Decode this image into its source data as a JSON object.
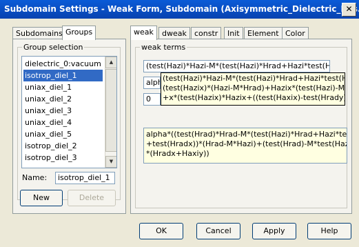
{
  "window": {
    "title": "Subdomain Settings - Weak Form, Subdomain (Axisymmetric_Dielectric_Res...",
    "close_glyph": "✕"
  },
  "left_tabs": [
    "Subdomains",
    "Groups"
  ],
  "group_selection": {
    "label": "Group selection",
    "items": [
      "dielectric_0:vacuum",
      "isotrop_diel_1",
      "uniax_diel_1",
      "uniax_diel_2",
      "uniax_diel_3",
      "uniax_diel_4",
      "uniax_diel_5",
      "isotrop_diel_2",
      "isotrop_diel_3"
    ],
    "selected_index": 1
  },
  "name_field": {
    "label": "Name:",
    "value": "isotrop_diel_1"
  },
  "left_buttons": {
    "new": "New",
    "delete": "Delete"
  },
  "right_tabs": [
    "weak",
    "dweak",
    "constr",
    "Init",
    "Element",
    "Color"
  ],
  "weak_terms": {
    "label": "weak terms",
    "field1": "(test(Hazi)*Hazi-M*(test(Hazi)*Hrad+Hazi*test(H",
    "field2": "alpha",
    "field3": "0",
    "tooltip_lines": [
      "(test(Hazi)*Hazi-M*(test(Hazi)*Hrad+Hazi*test(Hrad",
      "(test(Hazix)*(Hazi-M*Hrad)+Hazix*(test(Hazi)-M*test",
      "+x*(test(Hazix)*Hazix+((test(Haxix)-test(Hrady))*(H"
    ],
    "big_lines": [
      "alpha*((test(Hrad)*Hrad-M*(test(Hazi)*Hrad+Hazi*test(Hr",
      "+test(Hradx))*(Hrad-M*Hazi)+(test(Hrad)-M*test(Hazi))*(",
      "*(Hradx+Haxiy))"
    ]
  },
  "footer_buttons": {
    "ok": "OK",
    "cancel": "Cancel",
    "apply": "Apply",
    "help": "Help"
  },
  "colors": {
    "titlebar": "#0a5bd7",
    "selection": "#316ac5",
    "tooltip_bg": "#ffffe1"
  }
}
